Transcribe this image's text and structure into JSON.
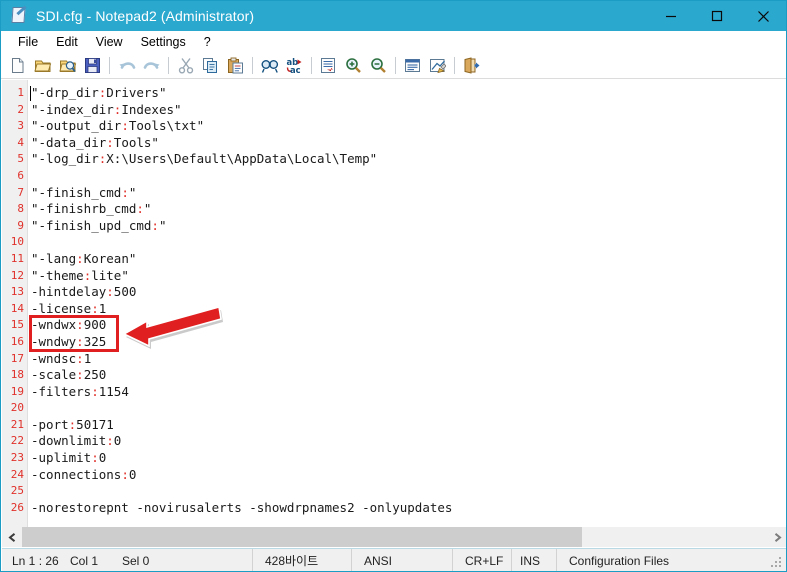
{
  "window": {
    "title": "SDI.cfg - Notepad2 (Administrator)",
    "title_icon": "notepad2-document-icon",
    "titlebar_color": "#2ba8ce",
    "controls": [
      {
        "name": "minimize-button",
        "glyph": "minimize"
      },
      {
        "name": "maximize-button",
        "glyph": "maximize"
      },
      {
        "name": "close-button",
        "glyph": "close"
      }
    ]
  },
  "menubar": {
    "items": [
      {
        "label": "File"
      },
      {
        "label": "Edit"
      },
      {
        "label": "View"
      },
      {
        "label": "Settings"
      },
      {
        "label": "?"
      }
    ]
  },
  "toolbar": {
    "buttons": [
      {
        "name": "new-file-icon",
        "tip": "New"
      },
      {
        "name": "open-file-icon",
        "tip": "Open"
      },
      {
        "name": "browse-file-icon",
        "tip": "Browse"
      },
      {
        "name": "save-file-icon",
        "tip": "Save"
      },
      {
        "name": "undo-icon",
        "tip": "Undo"
      },
      {
        "name": "redo-icon",
        "tip": "Redo"
      },
      {
        "name": "cut-icon",
        "tip": "Cut"
      },
      {
        "name": "copy-icon",
        "tip": "Copy"
      },
      {
        "name": "paste-icon",
        "tip": "Paste"
      },
      {
        "name": "find-icon",
        "tip": "Find"
      },
      {
        "name": "replace-icon",
        "tip": "Replace"
      },
      {
        "name": "goto-line-icon",
        "tip": "Go to line"
      },
      {
        "name": "zoom-in-icon",
        "tip": "Zoom In"
      },
      {
        "name": "zoom-out-icon",
        "tip": "Zoom Out"
      },
      {
        "name": "word-wrap-icon",
        "tip": "Word Wrap"
      },
      {
        "name": "edit-scheme-icon",
        "tip": "Edit Scheme"
      },
      {
        "name": "exit-icon",
        "tip": "Exit"
      }
    ]
  },
  "editor": {
    "line_number_color": "#e0302a",
    "gutter_color": "#f0f0f0",
    "lines": [
      {
        "n": "1",
        "text": "\"-drp_dir:Drivers\""
      },
      {
        "n": "2",
        "text": "\"-index_dir:Indexes\""
      },
      {
        "n": "3",
        "text": "\"-output_dir:Tools\\txt\""
      },
      {
        "n": "4",
        "text": "\"-data_dir:Tools\""
      },
      {
        "n": "5",
        "text": "\"-log_dir:X:\\Users\\Default\\AppData\\Local\\Temp\""
      },
      {
        "n": "6",
        "text": ""
      },
      {
        "n": "7",
        "text": "\"-finish_cmd:\""
      },
      {
        "n": "8",
        "text": "\"-finishrb_cmd:\""
      },
      {
        "n": "9",
        "text": "\"-finish_upd_cmd:\""
      },
      {
        "n": "10",
        "text": ""
      },
      {
        "n": "11",
        "text": "\"-lang:Korean\""
      },
      {
        "n": "12",
        "text": "\"-theme:lite\""
      },
      {
        "n": "13",
        "text": "-hintdelay:500"
      },
      {
        "n": "14",
        "text": "-license:1"
      },
      {
        "n": "15",
        "text": "-wndwx:900"
      },
      {
        "n": "16",
        "text": "-wndwy:325"
      },
      {
        "n": "17",
        "text": "-wndsc:1"
      },
      {
        "n": "18",
        "text": "-scale:250"
      },
      {
        "n": "19",
        "text": "-filters:1154"
      },
      {
        "n": "20",
        "text": ""
      },
      {
        "n": "21",
        "text": "-port:50171"
      },
      {
        "n": "22",
        "text": "-downlimit:0"
      },
      {
        "n": "23",
        "text": "-uplimit:0"
      },
      {
        "n": "24",
        "text": "-connections:0"
      },
      {
        "n": "25",
        "text": ""
      },
      {
        "n": "26",
        "text": "-norestorepnt -novirusalerts -showdrpnames2 -onlyupdates"
      }
    ]
  },
  "annotation": {
    "color": "#e02020",
    "highlighted_lines": [
      "15",
      "16"
    ],
    "shape": "rectangle-with-left-pointing-arrow"
  },
  "statusbar": {
    "line_info": "Ln 1 : 26",
    "column": "Col 1",
    "selection": "Sel 0",
    "bytes": "428바이트",
    "encoding": "ANSI",
    "eol": "CR+LF",
    "insert_mode": "INS",
    "scheme": "Configuration Files"
  }
}
